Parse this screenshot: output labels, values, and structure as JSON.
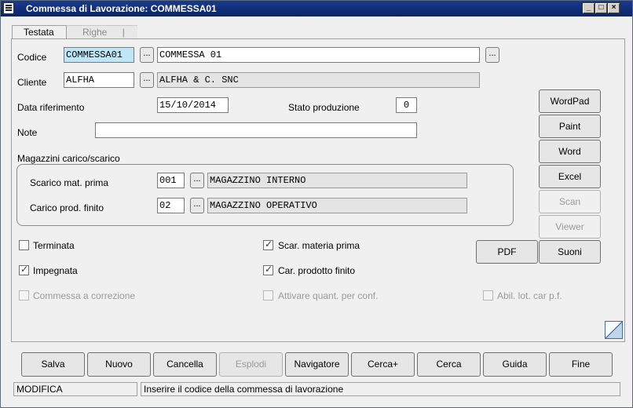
{
  "window": {
    "title": "Commessa di Lavorazione: COMMESSA01"
  },
  "tabs": [
    {
      "label": "Testata"
    },
    {
      "label": "Righe"
    }
  ],
  "form": {
    "codice_label": "Codice",
    "codice_value": "COMMESSA01",
    "codice_desc": "COMMESSA 01",
    "cliente_label": "Cliente",
    "cliente_value": "ALFHA",
    "cliente_desc": "ALFHA & C. SNC",
    "data_label": "Data riferimento",
    "data_value": "15/10/2014",
    "stato_label": "Stato produzione",
    "stato_value": "0",
    "note_label": "Note",
    "note_value": "",
    "browse_label": "..."
  },
  "magazzini": {
    "title": "Magazzini carico/scarico",
    "scarico_label": "Scarico mat. prima",
    "scarico_code": "001",
    "scarico_desc": "MAGAZZINO INTERNO",
    "carico_label": "Carico prod. finito",
    "carico_code": "02",
    "carico_desc": "MAGAZZINO OPERATIVO"
  },
  "side_buttons": [
    {
      "label": "WordPad",
      "enabled": true
    },
    {
      "label": "Paint",
      "enabled": true
    },
    {
      "label": "Word",
      "enabled": true
    },
    {
      "label": "Excel",
      "enabled": true
    },
    {
      "label": "Scan",
      "enabled": false
    },
    {
      "label": "Viewer",
      "enabled": false
    }
  ],
  "pdf_label": "PDF",
  "suoni_label": "Suoni",
  "checkboxes": {
    "terminata": {
      "label": "Terminata",
      "checked": false
    },
    "impegnata": {
      "label": "Impegnata",
      "checked": true
    },
    "correzione": {
      "label": "Commessa a correzione",
      "checked": false
    },
    "scar_materia": {
      "label": "Scar. materia prima",
      "checked": true
    },
    "car_prodotto": {
      "label": "Car. prodotto finito",
      "checked": true
    },
    "attivare": {
      "label": "Attivare quant. per conf.",
      "checked": false
    },
    "abil_lot": {
      "label": "Abil. lot. car p.f.",
      "checked": false
    }
  },
  "bottom_buttons": [
    {
      "label": "Salva",
      "enabled": true
    },
    {
      "label": "Nuovo",
      "enabled": true
    },
    {
      "label": "Cancella",
      "enabled": true
    },
    {
      "label": "Esplodi",
      "enabled": false
    },
    {
      "label": "Navigatore",
      "enabled": true
    },
    {
      "label": "Cerca+",
      "enabled": true
    },
    {
      "label": "Cerca",
      "enabled": true
    },
    {
      "label": "Guida",
      "enabled": true
    },
    {
      "label": "Fine",
      "enabled": true
    }
  ],
  "status": {
    "mode": "MODIFICA",
    "message": "Inserire il codice della commessa di lavorazione"
  },
  "colors": {
    "title_bar": "#0a246a",
    "highlight_field": "#bfe6f6"
  }
}
